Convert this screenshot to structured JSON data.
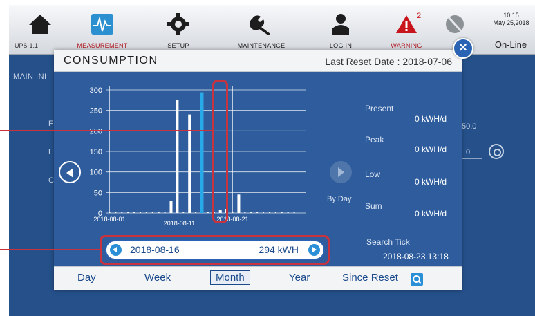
{
  "topbar": {
    "ups_label": "UPS-1.1",
    "nav": [
      {
        "label": "MEASUREMENT",
        "icon": "waveform-icon"
      },
      {
        "label": "SETUP",
        "icon": "gear-icon"
      },
      {
        "label": "MAINTENANCE",
        "icon": "wrench-icon"
      },
      {
        "label": "LOG IN",
        "icon": "user-icon"
      },
      {
        "label": "WARNING",
        "icon": "warning-icon",
        "badge": "2"
      },
      {
        "label": "",
        "icon": "mute-icon"
      }
    ],
    "time": "10:15",
    "date": "May 25,2018",
    "status": "On-Line"
  },
  "background": {
    "main_label": "MAIN INI",
    "row_labels": [
      "F",
      "L",
      "C"
    ],
    "values": [
      "50.0",
      "0"
    ]
  },
  "modal": {
    "title": "CONSUMPTION",
    "last_reset": "Last Reset Date : 2018-07-06",
    "by_day": "By Day",
    "stats": [
      {
        "label": "Present",
        "value": "0  kWH/d"
      },
      {
        "label": "Peak",
        "value": "0  kWH/d"
      },
      {
        "label": "Low",
        "value": "0  kWH/d"
      },
      {
        "label": "Sum",
        "value": "0  kWH/d"
      }
    ],
    "search_tick_label": "Search Tick",
    "search_tick_value": "2018-08-23 13:18",
    "selected_date": "2018-08-16",
    "selected_value": "294 kWH",
    "tabs": [
      "Day",
      "Week",
      "Month",
      "Year",
      "Since Reset"
    ],
    "active_tab": "Month"
  },
  "chart_data": {
    "type": "bar",
    "x_label_ticks": [
      "2018-08-01",
      "2018-08-11",
      "2018-08-21"
    ],
    "y_ticks": [
      0,
      50,
      100,
      150,
      200,
      250,
      300
    ],
    "ylim": [
      0,
      300
    ],
    "days": 31,
    "start_date": "2018-08-01",
    "values": [
      5,
      5,
      5,
      5,
      5,
      5,
      5,
      5,
      5,
      5,
      5,
      5,
      5,
      5,
      5,
      5,
      5,
      5,
      5,
      5,
      5,
      5,
      5,
      5,
      5,
      5,
      5,
      5,
      5,
      5,
      5
    ],
    "highlighted_day_index": 15,
    "highlighted_value": 294,
    "bars": [
      {
        "day": 11,
        "value": 30
      },
      {
        "day": 12,
        "value": 275
      },
      {
        "day": 14,
        "value": 240
      },
      {
        "day": 16,
        "value": 294
      },
      {
        "day": 19,
        "value": 8
      },
      {
        "day": 20,
        "value": 10
      },
      {
        "day": 22,
        "value": 45
      }
    ],
    "colors": {
      "bar": "#ffffff",
      "highlight": "#2aa9e8",
      "grid": "#ffffff"
    }
  },
  "callout_color": "#c9333e"
}
